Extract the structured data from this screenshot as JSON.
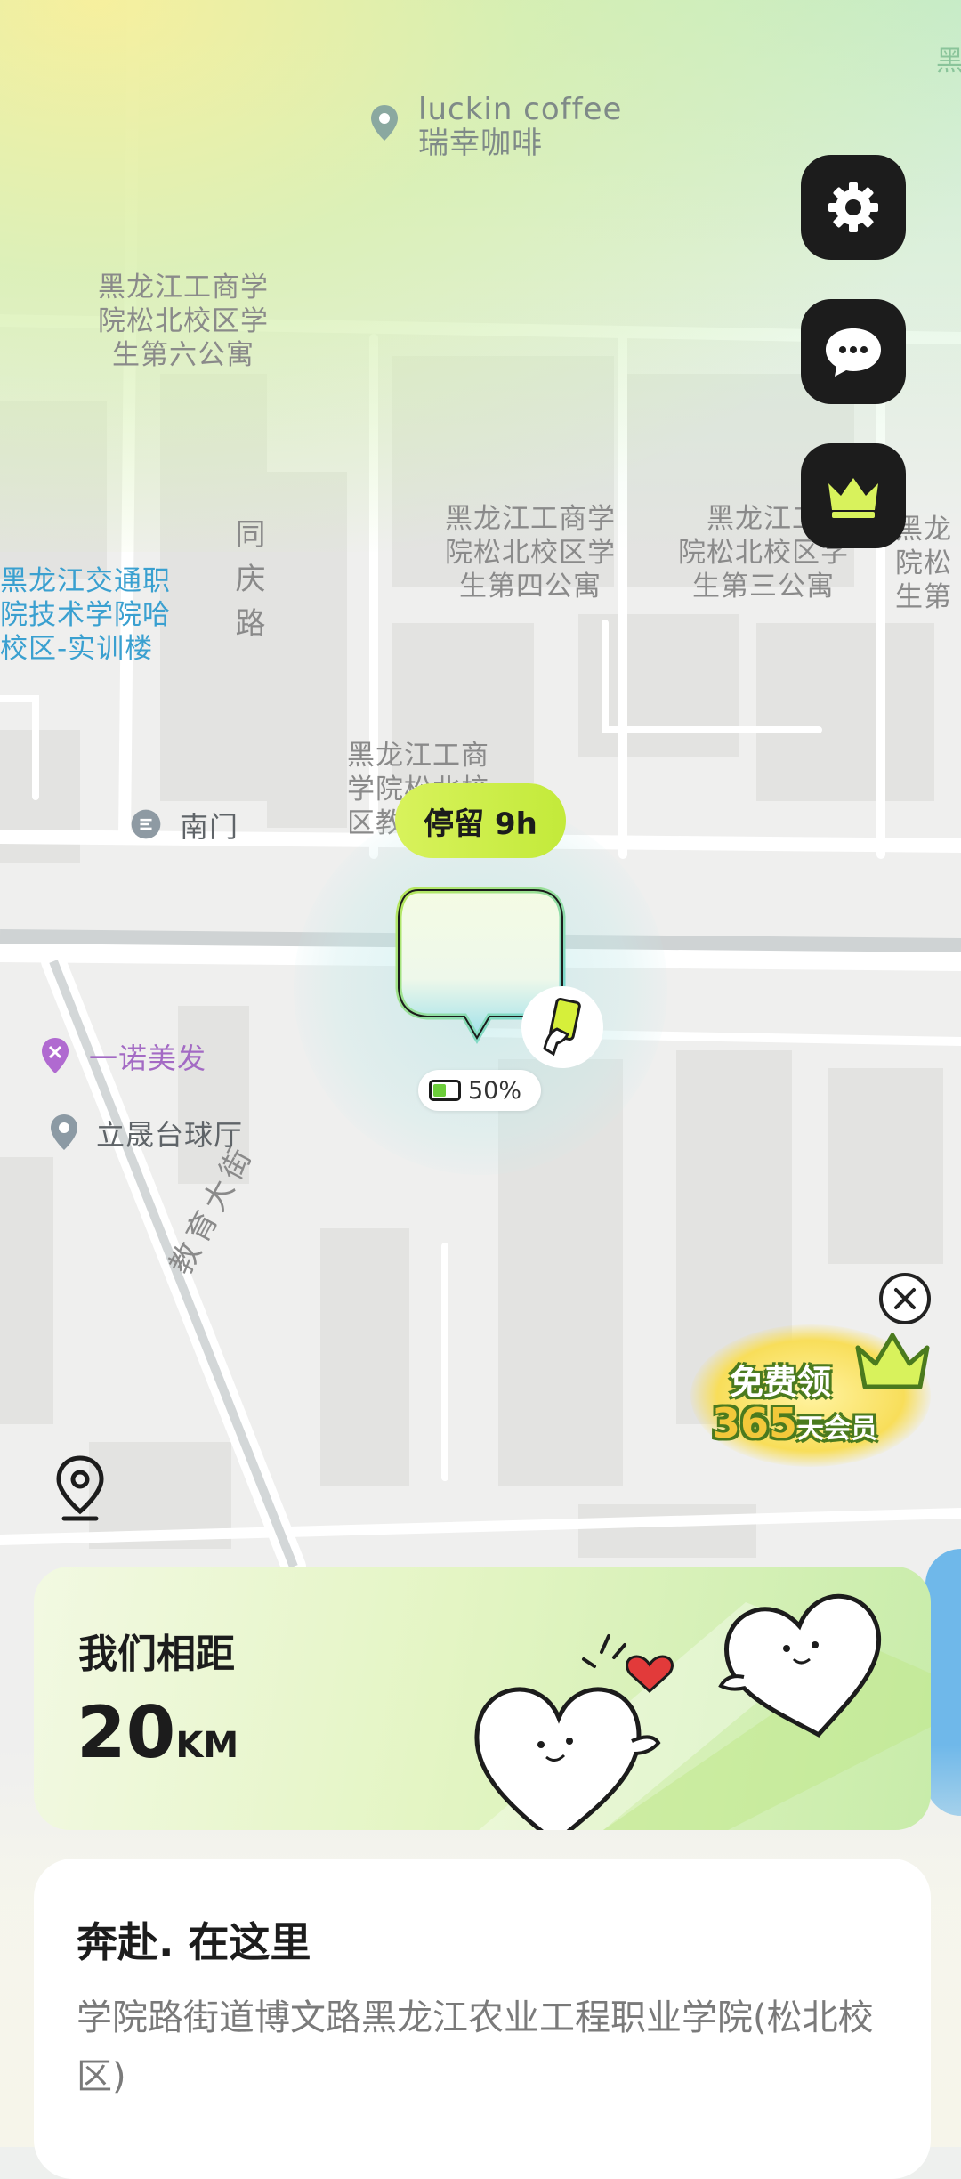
{
  "map": {
    "pois": {
      "luckin": {
        "line1": "luckin coffee",
        "line2": "瑞幸咖啡"
      },
      "dorm6": [
        "黑龙江工商学",
        "院松北校区学",
        "生第六公寓"
      ],
      "dorm4": [
        "黑龙江工商学",
        "院松北校区学",
        "生第四公寓"
      ],
      "dorm3": [
        "黑龙江工",
        "院松北校区学",
        "生第三公寓"
      ],
      "dorm_right": [
        "黑龙",
        "院松",
        "生第"
      ],
      "jiaotong": [
        "黑龙江交通职",
        "院技术学院哈",
        "校区-实训楼"
      ],
      "teaching": [
        "黑龙江工商",
        "学院松北校",
        "区教"
      ],
      "top_right_fragment": "黑",
      "south_gate": "南门",
      "salon": "一诺美发",
      "billiards": "立晟台球厅"
    },
    "roads": {
      "tongqing": "同庆路",
      "jiaoyu": "教育大街"
    }
  },
  "side_buttons": {
    "settings_icon": "gear-icon",
    "chat_icon": "chat-bubble-icon",
    "vip_icon": "crown-icon"
  },
  "marker": {
    "stay_label": "停留 9h",
    "battery": "50%",
    "device_icon": "phone-in-hand-icon"
  },
  "promo": {
    "line1": "免费领",
    "number": "365",
    "suffix": "天会员",
    "close_icon": "close-icon"
  },
  "distance_card": {
    "title": "我们相距",
    "value": "20",
    "unit": "KM"
  },
  "address_card": {
    "title": "奔赴. 在这里",
    "address": "学院路街道博文路黑龙江农业工程职业学院(松北校区)"
  },
  "colors": {
    "accent_green": "#c3ea3a",
    "button_dark": "#1c1c1c",
    "crown_yellow": "#d8f25c"
  }
}
